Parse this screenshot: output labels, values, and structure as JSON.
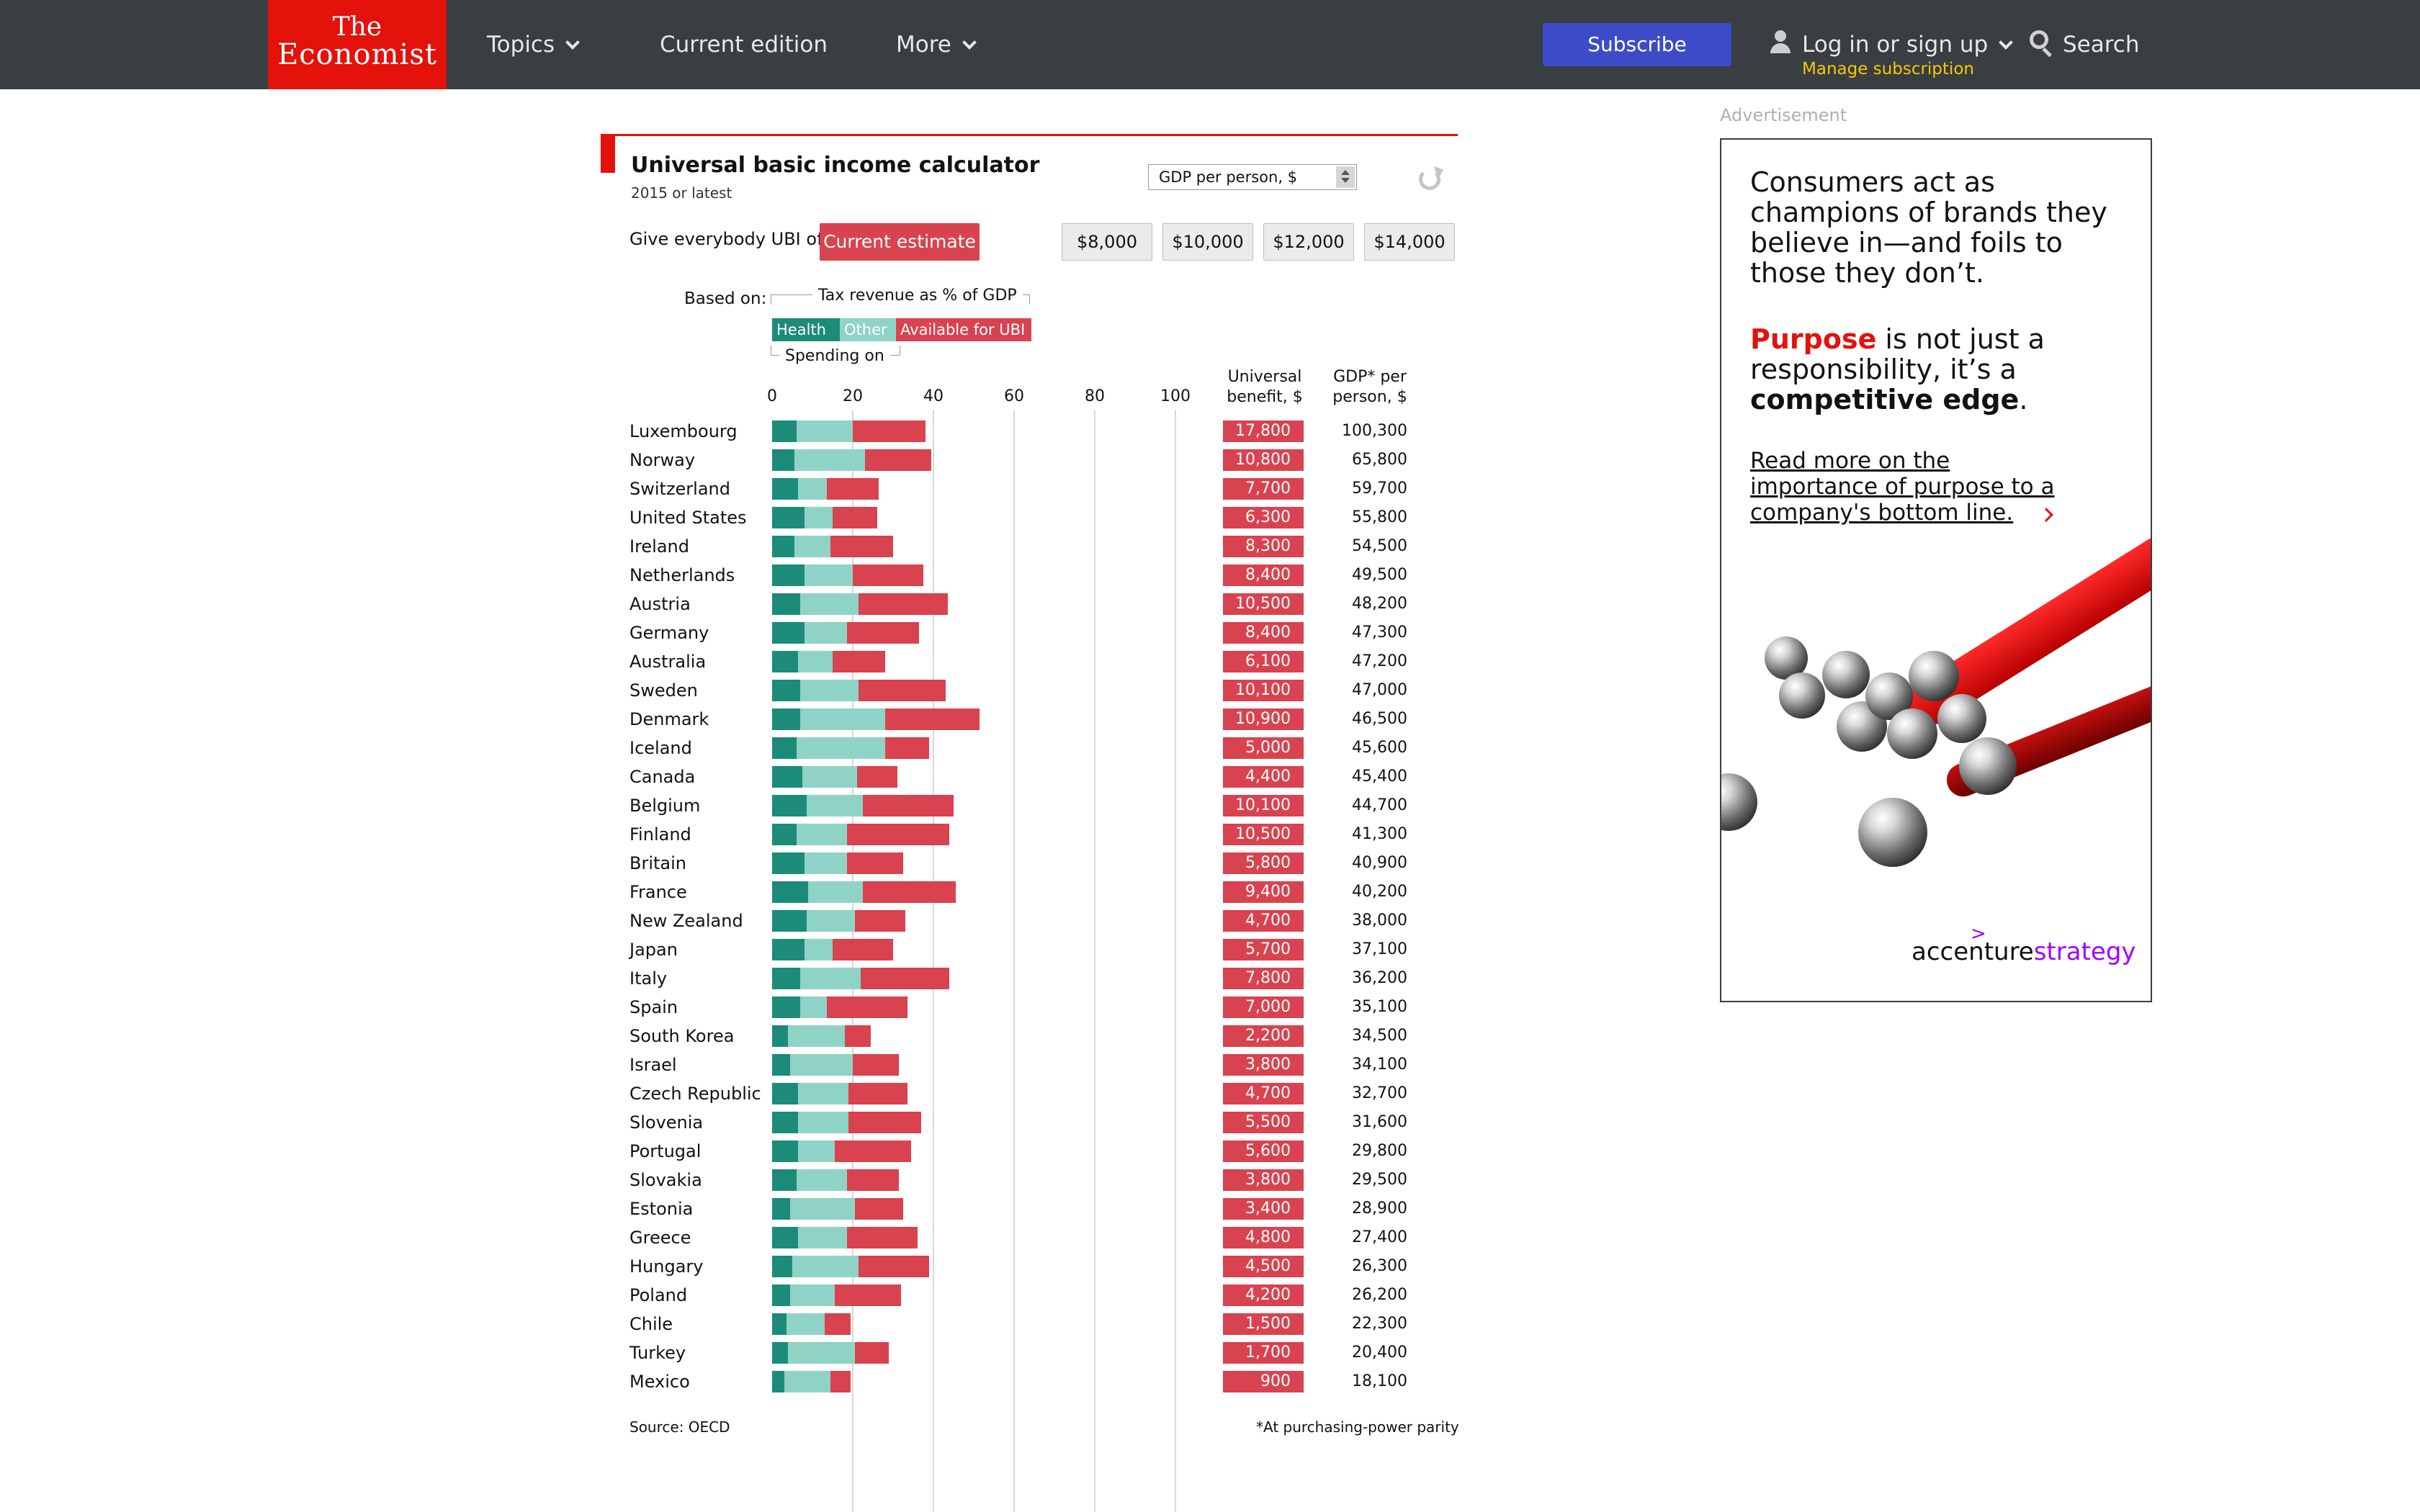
{
  "header": {
    "logo_line1": "The",
    "logo_line2": "Economist",
    "nav": {
      "topics": "Topics",
      "current_edition": "Current edition",
      "more": "More"
    },
    "subscribe": "Subscribe",
    "login": "Log in or sign up",
    "manage": "Manage subscription",
    "search": "Search"
  },
  "calculator": {
    "title": "Universal basic income calculator",
    "subtitle": "2015 or latest",
    "sort_select": "GDP per person, $",
    "give_label": "Give everybody UBI of:",
    "current_estimate": "Current estimate",
    "amount_buttons": [
      "$8,000",
      "$10,000",
      "$12,000",
      "$14,000"
    ],
    "based_on": "Based on:",
    "legend_top": "Tax revenue as % of GDP",
    "legend_health": "Health",
    "legend_other": "Other",
    "legend_ubi": "Available for UBI",
    "legend_bottom": "Spending on",
    "col_benefit": "Universal benefit, $",
    "col_gdp": "GDP* per person, $",
    "source": "Source: OECD",
    "note": "*At purchasing-power parity"
  },
  "chart_data": {
    "type": "bar",
    "stacked": true,
    "orientation": "horizontal",
    "xlim": [
      0,
      100
    ],
    "xticks": [
      0,
      20,
      40,
      60,
      80,
      100
    ],
    "series_colors": {
      "Health": "#1d8b79",
      "Other": "#8fd3c6",
      "Available for UBI": "#d9434f"
    },
    "rows": [
      {
        "country": "Luxembourg",
        "health": 6.0,
        "other": 14.0,
        "ubi": 18.0,
        "benefit": "17,800",
        "gdp": "100,300"
      },
      {
        "country": "Norway",
        "health": 5.5,
        "other": 17.5,
        "ubi": 16.5,
        "benefit": "10,800",
        "gdp": "65,800"
      },
      {
        "country": "Switzerland",
        "health": 6.5,
        "other": 7.0,
        "ubi": 13.0,
        "benefit": "7,700",
        "gdp": "59,700"
      },
      {
        "country": "United States",
        "health": 8.0,
        "other": 7.0,
        "ubi": 11.0,
        "benefit": "6,300",
        "gdp": "55,800"
      },
      {
        "country": "Ireland",
        "health": 5.5,
        "other": 9.0,
        "ubi": 15.5,
        "benefit": "8,300",
        "gdp": "54,500"
      },
      {
        "country": "Netherlands",
        "health": 8.0,
        "other": 12.0,
        "ubi": 17.5,
        "benefit": "8,400",
        "gdp": "49,500"
      },
      {
        "country": "Austria",
        "health": 7.0,
        "other": 14.5,
        "ubi": 22.0,
        "benefit": "10,500",
        "gdp": "48,200"
      },
      {
        "country": "Germany",
        "health": 8.0,
        "other": 10.5,
        "ubi": 18.0,
        "benefit": "8,400",
        "gdp": "47,300"
      },
      {
        "country": "Australia",
        "health": 6.5,
        "other": 8.5,
        "ubi": 13.0,
        "benefit": "6,100",
        "gdp": "47,200"
      },
      {
        "country": "Sweden",
        "health": 7.0,
        "other": 14.5,
        "ubi": 21.5,
        "benefit": "10,100",
        "gdp": "47,000"
      },
      {
        "country": "Denmark",
        "health": 7.0,
        "other": 21.0,
        "ubi": 23.5,
        "benefit": "10,900",
        "gdp": "46,500"
      },
      {
        "country": "Iceland",
        "health": 6.0,
        "other": 22.0,
        "ubi": 11.0,
        "benefit": "5,000",
        "gdp": "45,600"
      },
      {
        "country": "Canada",
        "health": 7.5,
        "other": 13.5,
        "ubi": 10.0,
        "benefit": "4,400",
        "gdp": "45,400"
      },
      {
        "country": "Belgium",
        "health": 8.5,
        "other": 14.0,
        "ubi": 22.5,
        "benefit": "10,100",
        "gdp": "44,700"
      },
      {
        "country": "Finland",
        "health": 6.0,
        "other": 12.5,
        "ubi": 25.5,
        "benefit": "10,500",
        "gdp": "41,300"
      },
      {
        "country": "Britain",
        "health": 8.0,
        "other": 10.5,
        "ubi": 14.0,
        "benefit": "5,800",
        "gdp": "40,900"
      },
      {
        "country": "France",
        "health": 9.0,
        "other": 13.5,
        "ubi": 23.0,
        "benefit": "9,400",
        "gdp": "40,200"
      },
      {
        "country": "New Zealand",
        "health": 8.5,
        "other": 12.0,
        "ubi": 12.5,
        "benefit": "4,700",
        "gdp": "38,000"
      },
      {
        "country": "Japan",
        "health": 8.0,
        "other": 7.0,
        "ubi": 15.0,
        "benefit": "5,700",
        "gdp": "37,100"
      },
      {
        "country": "Italy",
        "health": 7.0,
        "other": 15.0,
        "ubi": 22.0,
        "benefit": "7,800",
        "gdp": "36,200"
      },
      {
        "country": "Spain",
        "health": 7.0,
        "other": 6.5,
        "ubi": 20.0,
        "benefit": "7,000",
        "gdp": "35,100"
      },
      {
        "country": "South Korea",
        "health": 4.0,
        "other": 14.0,
        "ubi": 6.5,
        "benefit": "2,200",
        "gdp": "34,500"
      },
      {
        "country": "Israel",
        "health": 4.5,
        "other": 15.5,
        "ubi": 11.5,
        "benefit": "3,800",
        "gdp": "34,100"
      },
      {
        "country": "Czech Republic",
        "health": 6.5,
        "other": 12.5,
        "ubi": 14.5,
        "benefit": "4,700",
        "gdp": "32,700"
      },
      {
        "country": "Slovenia",
        "health": 6.5,
        "other": 12.5,
        "ubi": 18.0,
        "benefit": "5,500",
        "gdp": "31,600"
      },
      {
        "country": "Portugal",
        "health": 6.5,
        "other": 9.0,
        "ubi": 19.0,
        "benefit": "5,600",
        "gdp": "29,800"
      },
      {
        "country": "Slovakia",
        "health": 6.0,
        "other": 12.5,
        "ubi": 13.0,
        "benefit": "3,800",
        "gdp": "29,500"
      },
      {
        "country": "Estonia",
        "health": 4.5,
        "other": 16.0,
        "ubi": 12.0,
        "benefit": "3,400",
        "gdp": "28,900"
      },
      {
        "country": "Greece",
        "health": 6.5,
        "other": 12.0,
        "ubi": 17.5,
        "benefit": "4,800",
        "gdp": "27,400"
      },
      {
        "country": "Hungary",
        "health": 5.0,
        "other": 16.5,
        "ubi": 17.5,
        "benefit": "4,500",
        "gdp": "26,300"
      },
      {
        "country": "Poland",
        "health": 4.5,
        "other": 11.0,
        "ubi": 16.5,
        "benefit": "4,200",
        "gdp": "26,200"
      },
      {
        "country": "Chile",
        "health": 3.5,
        "other": 9.5,
        "ubi": 6.5,
        "benefit": "1,500",
        "gdp": "22,300"
      },
      {
        "country": "Turkey",
        "health": 4.0,
        "other": 16.5,
        "ubi": 8.5,
        "benefit": "1,700",
        "gdp": "20,400"
      },
      {
        "country": "Mexico",
        "health": 3.0,
        "other": 11.5,
        "ubi": 5.0,
        "benefit": "900",
        "gdp": "18,100"
      }
    ]
  },
  "ad": {
    "label": "Advertisement",
    "text1": "Consumers act as champions of brands they believe in—and foils to those they don’t.",
    "purpose": "Purpose",
    "text2a": " is not just a responsibility, it’s a ",
    "text2b": "competitive edge",
    "text2c": ".",
    "link": "Read more on the importance of purpose to a company's bottom line.",
    "brand_a": "accenture",
    "brand_b": "strategy",
    "brand_gt": ">"
  }
}
